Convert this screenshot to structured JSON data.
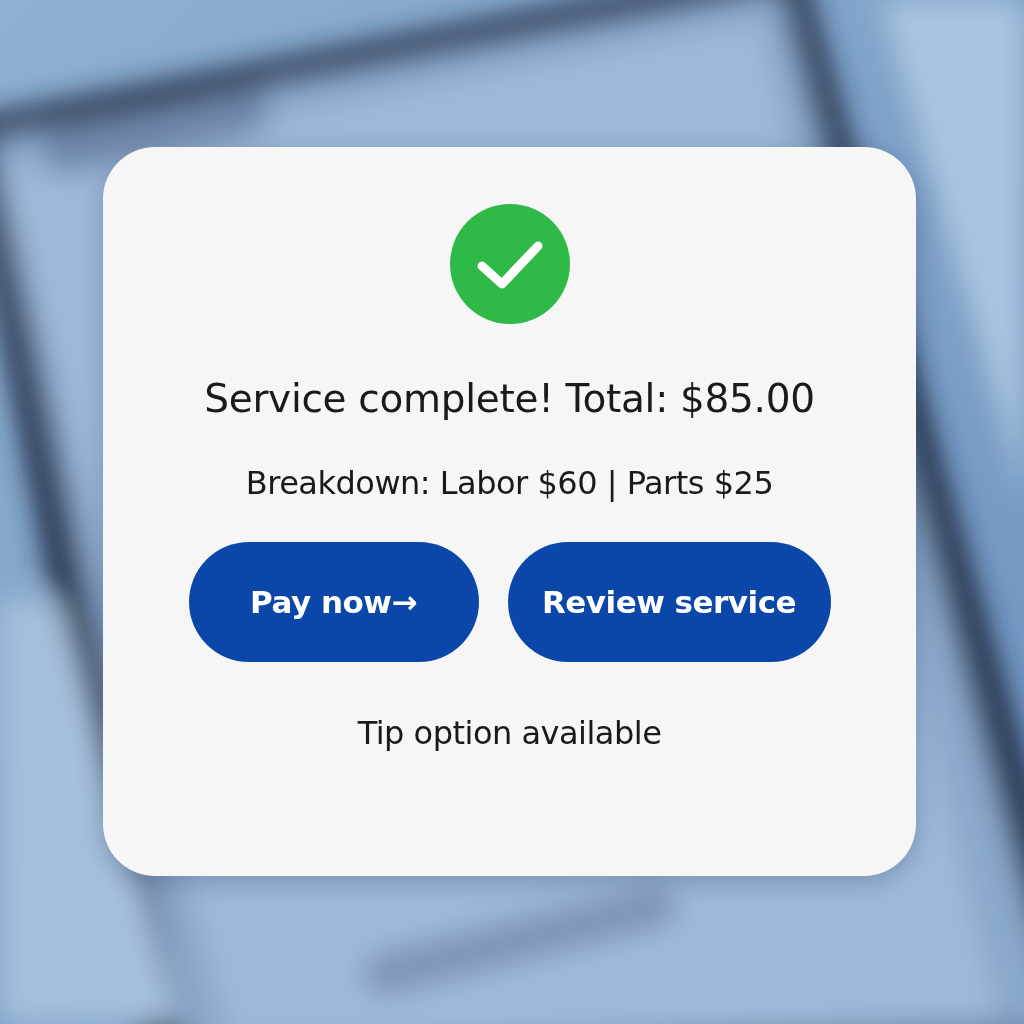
{
  "dialog": {
    "title": "Service complete! Total: $85.00",
    "breakdown": "Breakdown: Labor $60 | Parts $25",
    "buttons": [
      {
        "label": "Pay now→"
      },
      {
        "label": "Review service"
      }
    ],
    "note": "Tip option available"
  }
}
